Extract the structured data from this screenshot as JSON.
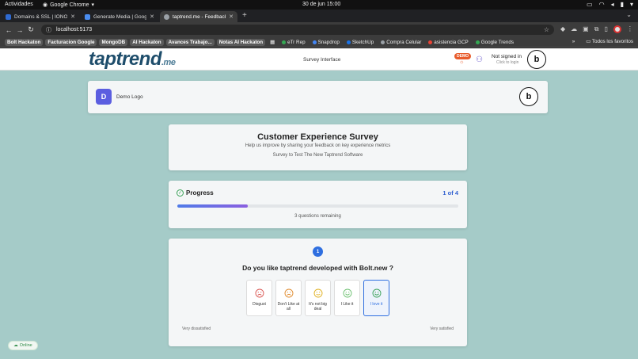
{
  "os": {
    "activities": "Actividades",
    "app_name": "Google Chrome",
    "clock": "30 de jun  15:00"
  },
  "browser": {
    "tabs": [
      {
        "label": "Domains & SSL | IONOS",
        "favicon_color": "#2e6ad1"
      },
      {
        "label": "Generate Media | Googl",
        "favicon_color": "#4a8df0"
      },
      {
        "label": "taptrend.me - Feedback",
        "favicon_color": "#9aa0a6",
        "active": true
      }
    ],
    "url": "localhost:5173",
    "bookmarks": [
      {
        "label": "Bolt Hackaton",
        "chip": true
      },
      {
        "label": "Facturacion Google",
        "chip": true
      },
      {
        "label": "MongoDB",
        "chip": true
      },
      {
        "label": "AI Hackaton",
        "chip": true
      },
      {
        "label": "Avances Trabajo...",
        "chip": true
      },
      {
        "label": "Notas AI Hackaton",
        "chip": true
      },
      {
        "label": "eTr Rep",
        "dot": "#34a853"
      },
      {
        "label": "Snapdrop",
        "dot": "#4285f4"
      },
      {
        "label": "SketchUp",
        "dot": "#1a73e8"
      },
      {
        "label": "Compra Celular",
        "dot": "#9aa0a6"
      },
      {
        "label": "asistencia GCP",
        "dot": "#ea4335"
      },
      {
        "label": "Google Trends",
        "dot": "#34a853"
      }
    ],
    "all_bookmarks": "Todos los favoritos"
  },
  "header": {
    "logo_main": "taptrend",
    "logo_suffix": ".me",
    "center_text": "Survey Interface",
    "demo_badge": "DEMO",
    "signin_title": "Not signed in",
    "signin_sub": "Click to login"
  },
  "brand_card": {
    "avatar_letter": "D",
    "label": "Demo Logo"
  },
  "intro": {
    "title": "Customer Experience Survey",
    "subtitle": "Help us improve by sharing your feedback on key experience metrics",
    "survey_name": "Survey to Test The New Taptrend Software"
  },
  "progress": {
    "title": "Progress",
    "counter": "1 of 4",
    "fraction": 0.25,
    "remaining": "3 questions remaining"
  },
  "question": {
    "number": "1",
    "text": "Do you like taptrend developed with Bolt.new ?",
    "options": [
      {
        "label": "Disgust",
        "color": "#d9534f",
        "mood": "sad"
      },
      {
        "label": "Don't Like at all",
        "color": "#e08a2c",
        "mood": "sad"
      },
      {
        "label": "It's not big deal",
        "color": "#e0b020",
        "mood": "neutral"
      },
      {
        "label": "I Like it",
        "color": "#6cc070",
        "mood": "happy"
      },
      {
        "label": "I love it",
        "color": "#3aa157",
        "mood": "happy",
        "selected": true
      }
    ],
    "scale_low": "Very dissatisfied",
    "scale_high": "Very satisfied"
  },
  "status": {
    "label": "Online"
  },
  "colors": {
    "accent": "#2f6fe0",
    "brand_dark": "#1e4d6b",
    "page_bg": "#a5cbc8"
  }
}
